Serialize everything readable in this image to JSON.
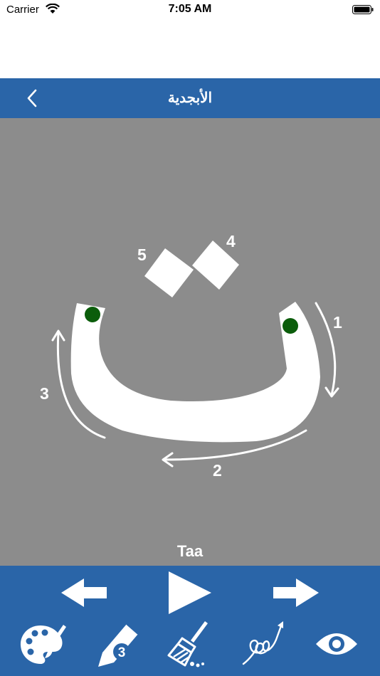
{
  "status_bar": {
    "carrier": "Carrier",
    "time": "7:05 AM"
  },
  "nav": {
    "title": "الأبجدية",
    "back_icon": "chevron-left-icon"
  },
  "letter": {
    "name": "Taa",
    "stroke_numbers": [
      "1",
      "2",
      "3",
      "4",
      "5"
    ]
  },
  "toolbar": {
    "row1": [
      "arrow-left-icon",
      "play-icon",
      "arrow-right-icon"
    ],
    "row2": [
      "palette-icon",
      "pencil-icon",
      "broom-icon",
      "scribble-icon",
      "eye-icon"
    ],
    "pencil_badge": "3"
  },
  "colors": {
    "nav": "#2a65a8",
    "canvas": "#8c8c8c",
    "start_dot": "#0b5d0b"
  }
}
